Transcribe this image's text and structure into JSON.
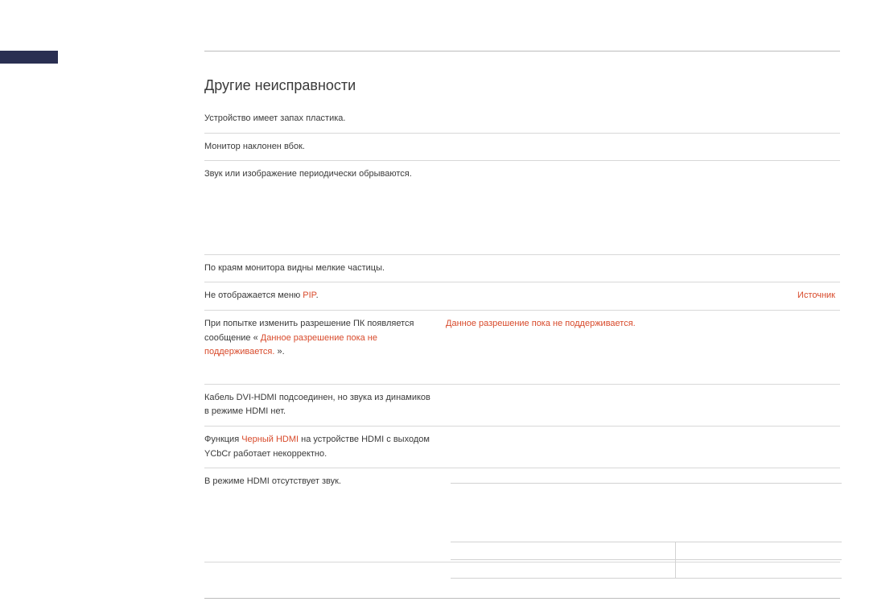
{
  "section_title": "Другие неисправности",
  "rows": [
    {
      "problem_parts": [
        {
          "text": "Устройство имеет запах пластика.",
          "class": ""
        }
      ],
      "solution_parts": []
    },
    {
      "problem_parts": [
        {
          "text": "Монитор наклонен вбок.",
          "class": ""
        }
      ],
      "solution_parts": []
    },
    {
      "problem_parts": [
        {
          "text": "Звук или изображение периодически обрываются.",
          "class": ""
        }
      ],
      "solution_parts": [],
      "tall": true
    },
    {
      "problem_parts": [
        {
          "text": "По краям монитора видны мелкие частицы.",
          "class": ""
        }
      ],
      "solution_parts": []
    },
    {
      "problem_parts": [
        {
          "text": "Не отображается меню ",
          "class": ""
        },
        {
          "text": "PIP",
          "class": "highlight-red"
        },
        {
          "text": ".",
          "class": ""
        }
      ],
      "solution_parts": [
        {
          "text": "Источник",
          "class": "highlight-red",
          "align": "right"
        }
      ]
    },
    {
      "problem_parts": [
        {
          "text": "При попытке изменить разрешение ПК появляется сообщение «",
          "class": ""
        },
        {
          "text": " Данное разрешение пока не поддерживается. ",
          "class": "highlight-red"
        },
        {
          "text": " ».",
          "class": ""
        }
      ],
      "solution_parts": [
        {
          "text": "Данное разрешение пока не поддерживается.",
          "class": "highlight-red"
        }
      ],
      "tall2": true
    },
    {
      "problem_parts": [
        {
          "text": "Кабель DVI-HDMI подсоединен, но звука из динамиков в режиме HDMI нет.",
          "class": ""
        }
      ],
      "solution_parts": []
    },
    {
      "problem_parts": [
        {
          "text": "Функция ",
          "class": ""
        },
        {
          "text": "Черный HDMI",
          "class": "highlight-red"
        },
        {
          "text": "  на устройстве HDMI с выходом YCbCr работает некорректно.",
          "class": ""
        }
      ],
      "solution_parts": []
    },
    {
      "problem_parts": [
        {
          "text": "В режиме HDMI отсутствует звук.",
          "class": ""
        }
      ],
      "solution_parts": [],
      "tall": true
    }
  ]
}
